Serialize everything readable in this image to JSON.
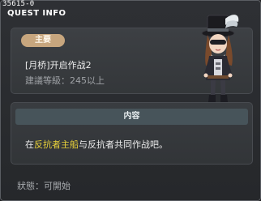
{
  "window": {
    "id": "35615-0",
    "title": "QUEST INFO"
  },
  "quest": {
    "type_badge": "主要",
    "name": "[月桥]开启作战2",
    "level": "建議等級：245以上"
  },
  "content": {
    "header": "内容",
    "highlight": "反抗者主船",
    "before": "在",
    "after": "与反抗者共同作战吧。"
  },
  "status": {
    "label": "狀態：",
    "value": "可開始"
  },
  "colors": {
    "highlight": "#e9d23a",
    "badge": "#c7a67e",
    "content_bar": "#47545a"
  },
  "icons": {
    "npc": "npc-portrait-top-hat-woman"
  }
}
